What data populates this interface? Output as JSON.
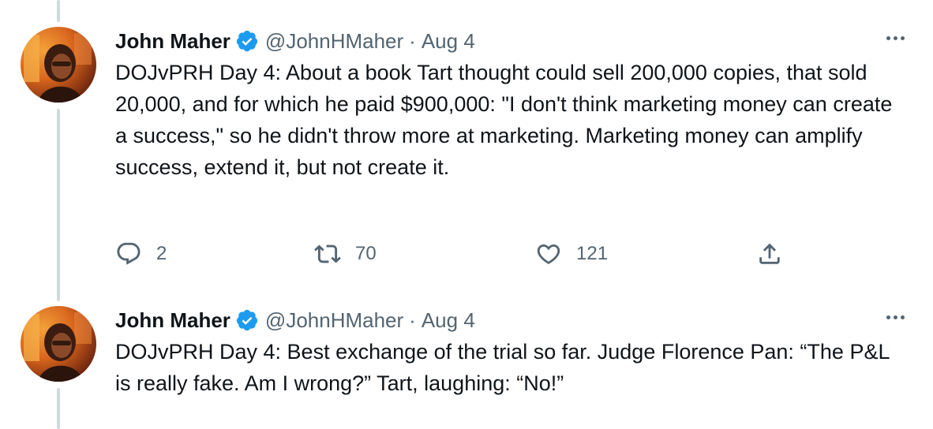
{
  "tweets": [
    {
      "author_name": "John Maher",
      "handle": "@JohnHMaher",
      "separator": "·",
      "date": "Aug 4",
      "text": "DOJvPRH Day 4: About a book Tart thought could sell 200,000 copies, that sold 20,000, and for which he paid $900,000: \"I don't think marketing money can create a success,\" so he didn't throw more at marketing. Marketing money can amplify success, extend it, but not create it.",
      "replies": "2",
      "retweets": "70",
      "likes": "121"
    },
    {
      "author_name": "John Maher",
      "handle": "@JohnHMaher",
      "separator": "·",
      "date": "Aug 4",
      "text": "DOJvPRH Day 4: Best exchange of the trial so far. Judge Florence Pan: “The P&L is really fake. Am I wrong?” Tart, laughing: “No!”"
    }
  ],
  "icons": {
    "verified": "verified-badge-icon",
    "more": "more-options-icon",
    "reply": "reply-icon",
    "retweet": "retweet-icon",
    "like": "like-icon",
    "share": "share-icon"
  },
  "colors": {
    "verified_blue": "#1d9bf0",
    "secondary_text": "#536471",
    "thread_line": "#cfd9de"
  }
}
